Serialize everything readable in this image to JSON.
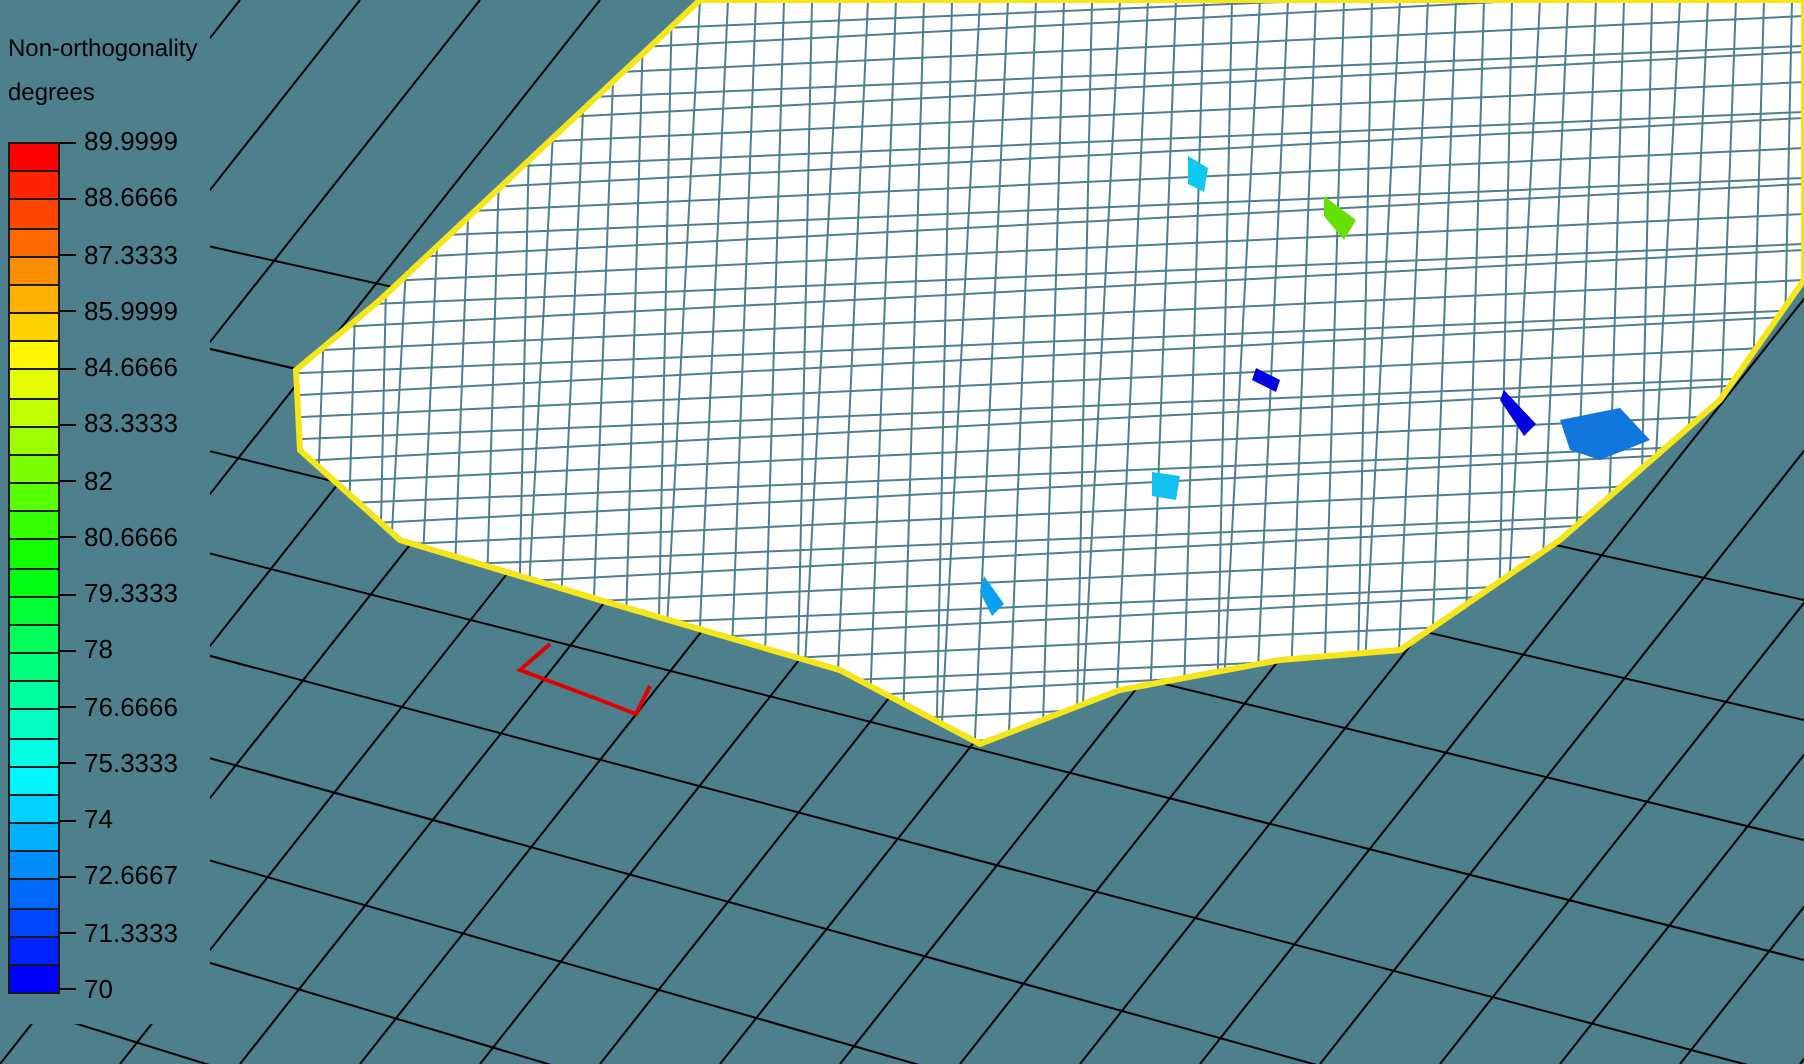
{
  "legend": {
    "title": "Non-orthogonality",
    "unit": "degrees",
    "ticks": [
      "89.9999",
      "88.6666",
      "87.3333",
      "85.9999",
      "84.6666",
      "83.3333",
      "82",
      "80.6666",
      "79.3333",
      "78",
      "76.6666",
      "75.3333",
      "74",
      "72.6667",
      "71.3333",
      "70"
    ]
  }
}
